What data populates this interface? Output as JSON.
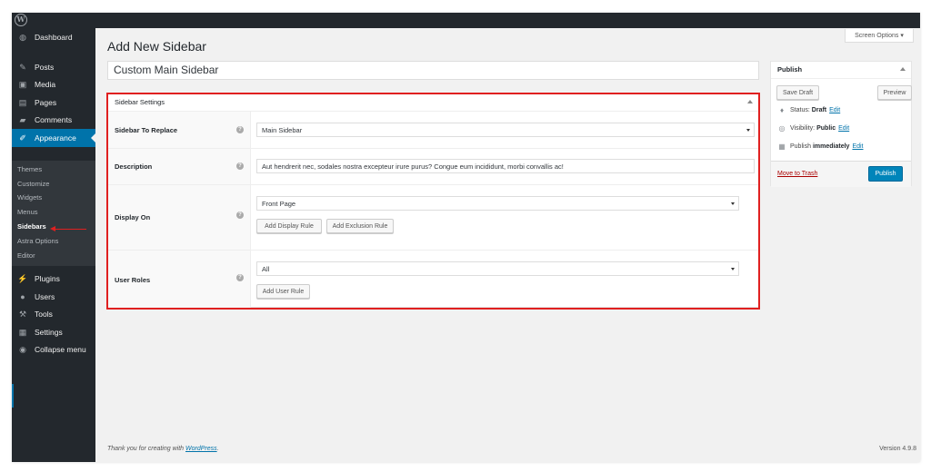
{
  "menu": {
    "dashboard": "Dashboard",
    "posts": "Posts",
    "media": "Media",
    "pages": "Pages",
    "comments": "Comments",
    "appearance": "Appearance",
    "plugins": "Plugins",
    "users": "Users",
    "tools": "Tools",
    "settings": "Settings",
    "collapse": "Collapse menu"
  },
  "submenu": {
    "themes": "Themes",
    "customize": "Customize",
    "widgets": "Widgets",
    "menus": "Menus",
    "sidebars": "Sidebars",
    "astra_options": "Astra Options",
    "editor": "Editor"
  },
  "screen_options": "Screen Options",
  "page_title": "Add New Sidebar",
  "sidebar_title_value": "Custom Main Sidebar",
  "settings": {
    "box_title": "Sidebar Settings",
    "rows": {
      "replace_label": "Sidebar To Replace",
      "replace_value": "Main Sidebar",
      "description_label": "Description",
      "description_value": "Aut hendrerit nec, sodales nostra excepteur irure purus? Congue eum incididunt, morbi convallis ac!",
      "display_label": "Display On",
      "display_value": "Front Page",
      "add_display_rule": "Add Display Rule",
      "add_exclusion_rule": "Add Exclusion Rule",
      "roles_label": "User Roles",
      "roles_value": "All",
      "add_user_rule": "Add User Rule"
    }
  },
  "publish": {
    "title": "Publish",
    "save_draft": "Save Draft",
    "preview": "Preview",
    "status_label": "Status:",
    "status_value": "Draft",
    "visibility_label": "Visibility:",
    "visibility_value": "Public",
    "publish_label": "Publish",
    "publish_value": "immediately",
    "edit": "Edit",
    "trash": "Move to Trash",
    "publish_button": "Publish"
  },
  "footer": {
    "thanks_prefix": "Thank you for creating with",
    "wordpress": "WordPress",
    "period": ".",
    "version": "Version 4.9.8"
  },
  "colors": {
    "accent": "#0073aa",
    "admin_dark": "#23282d",
    "highlight_red": "#e02020",
    "publish_button": "#0085ba"
  }
}
